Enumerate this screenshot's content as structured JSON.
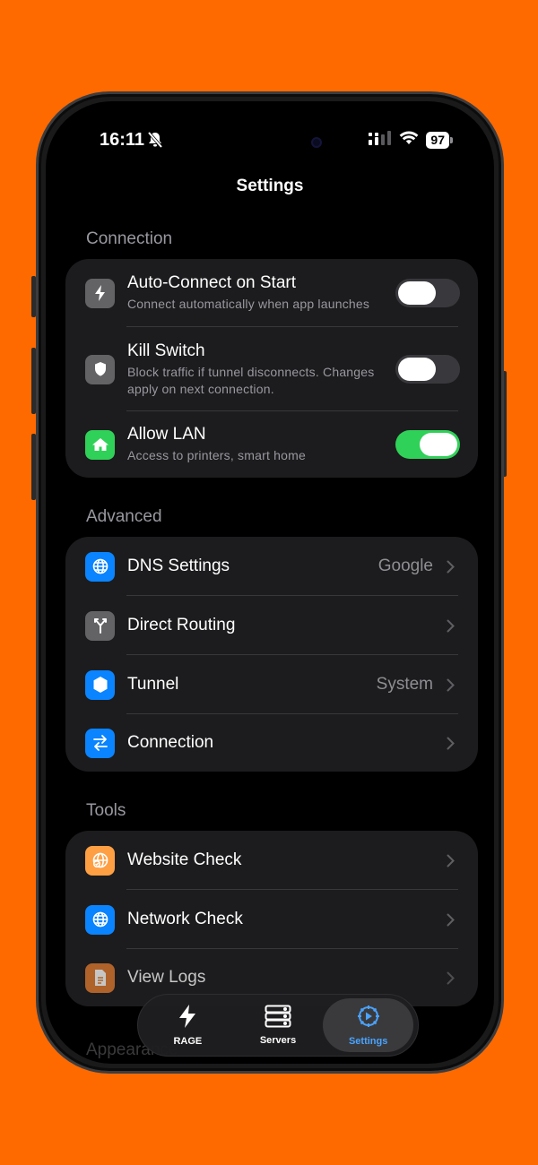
{
  "status": {
    "time": "16:11",
    "battery": "97"
  },
  "nav": {
    "title": "Settings"
  },
  "sections": {
    "connection": {
      "title": "Connection",
      "rows": [
        {
          "title": "Auto-Connect on Start",
          "subtitle": "Connect automatically when app launches",
          "toggle": "off",
          "icon": "bolt-icon",
          "color": "#636366"
        },
        {
          "title": "Kill Switch",
          "subtitle": "Block traffic if tunnel disconnects. Changes apply on next connection.",
          "toggle": "off",
          "icon": "shield-icon",
          "color": "#636366"
        },
        {
          "title": "Allow LAN",
          "subtitle": "Access to printers, smart home",
          "toggle": "on",
          "icon": "house-icon",
          "color": "#30d158"
        }
      ]
    },
    "advanced": {
      "title": "Advanced",
      "rows": [
        {
          "title": "DNS Settings",
          "value": "Google",
          "icon": "globe-icon",
          "color": "#0a84ff"
        },
        {
          "title": "Direct Routing",
          "value": "",
          "icon": "fork-icon",
          "color": "#636366"
        },
        {
          "title": "Tunnel",
          "value": "System",
          "icon": "hexagon-icon",
          "color": "#0a84ff"
        },
        {
          "title": "Connection",
          "value": "",
          "icon": "arrows-icon",
          "color": "#0a84ff"
        }
      ]
    },
    "tools": {
      "title": "Tools",
      "rows": [
        {
          "title": "Website Check",
          "icon": "web-check-icon",
          "color": "#ff9f43"
        },
        {
          "title": "Network Check",
          "icon": "globe-icon",
          "color": "#0a84ff"
        },
        {
          "title": "View Logs",
          "icon": "doc-icon",
          "color": "#e07a2e"
        }
      ]
    },
    "appearance": {
      "title": "Appearance"
    }
  },
  "tabbar": {
    "tabs": [
      {
        "label": "RAGE",
        "icon": "bolt-icon",
        "active": false
      },
      {
        "label": "Servers",
        "icon": "servers-icon",
        "active": false
      },
      {
        "label": "Settings",
        "icon": "gear-icon",
        "active": true
      }
    ]
  }
}
